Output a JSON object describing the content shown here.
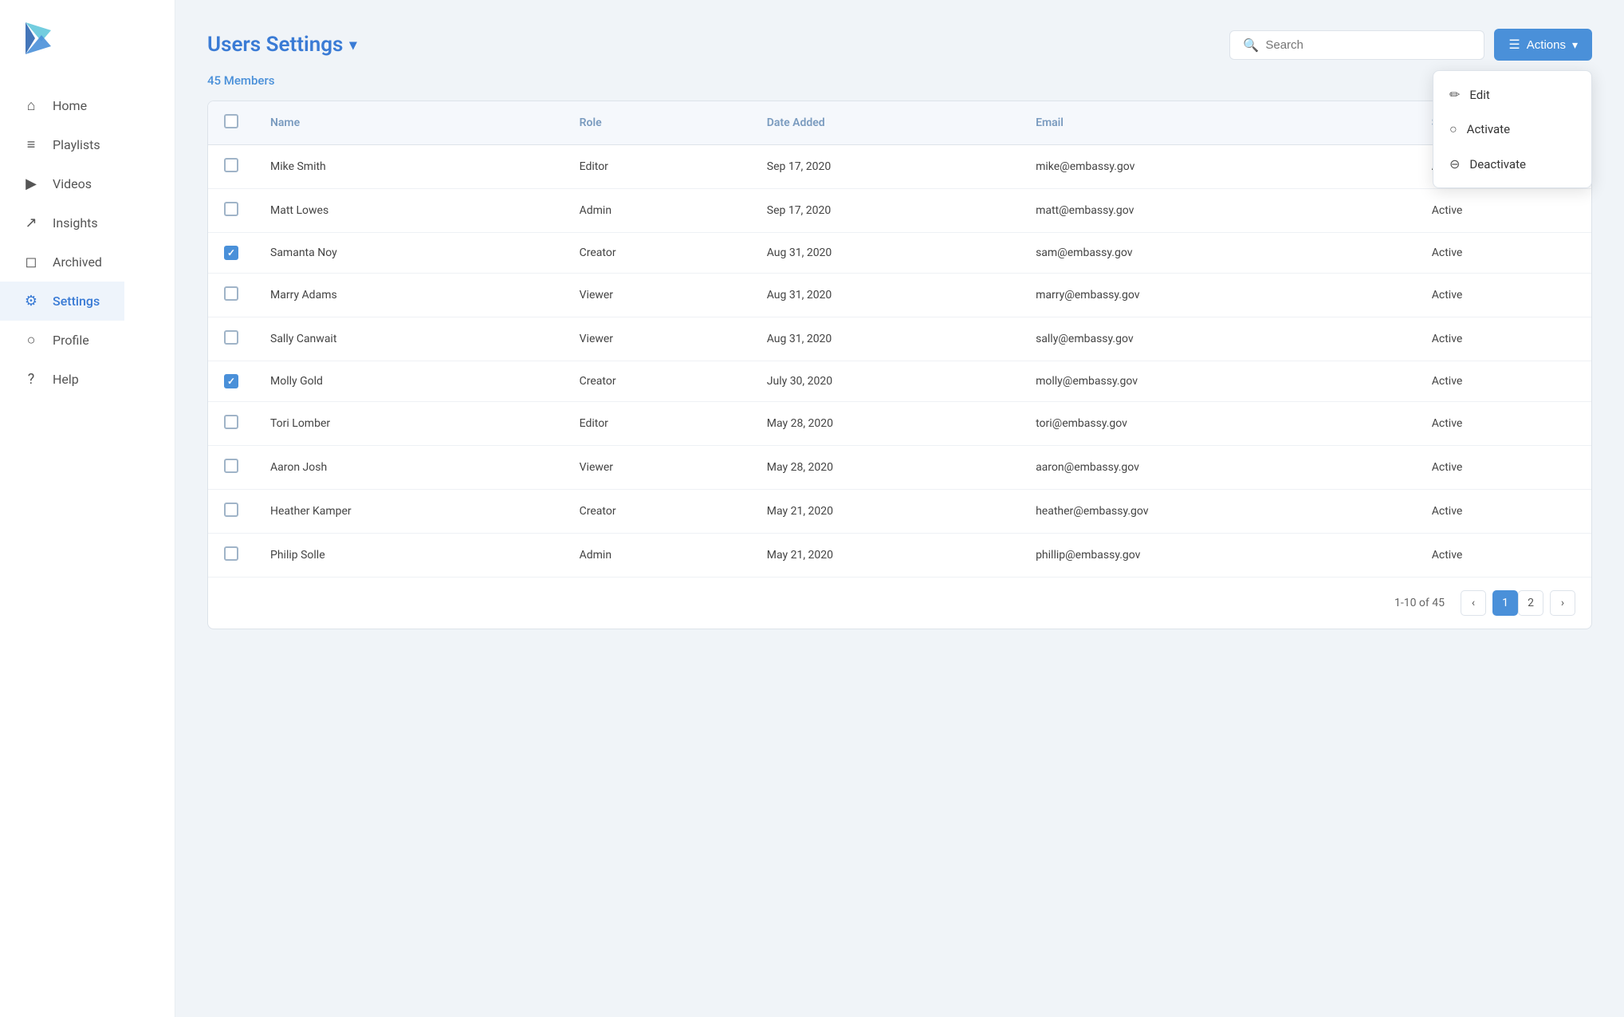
{
  "sidebar": {
    "logo_alt": "PlayVS logo",
    "items": [
      {
        "id": "home",
        "label": "Home",
        "icon": "⌂",
        "active": false
      },
      {
        "id": "playlists",
        "label": "Playlists",
        "icon": "≡",
        "active": false
      },
      {
        "id": "videos",
        "label": "Videos",
        "icon": "▶",
        "active": false
      },
      {
        "id": "insights",
        "label": "Insights",
        "icon": "📈",
        "active": false
      },
      {
        "id": "archived",
        "label": "Archived",
        "icon": "⬡",
        "active": false
      },
      {
        "id": "settings",
        "label": "Settings",
        "icon": "⚙",
        "active": true
      },
      {
        "id": "profile",
        "label": "Profile",
        "icon": "👤",
        "active": false
      },
      {
        "id": "help",
        "label": "Help",
        "icon": "?",
        "active": false
      }
    ]
  },
  "header": {
    "page_title": "Users Settings",
    "chevron_label": "▾",
    "members_count": "45 Members",
    "search_placeholder": "Search",
    "actions_label": "Actions",
    "actions_chevron": "▾"
  },
  "actions_dropdown": {
    "items": [
      {
        "id": "edit",
        "label": "Edit",
        "icon": "✏"
      },
      {
        "id": "activate",
        "label": "Activate",
        "icon": "○"
      },
      {
        "id": "deactivate",
        "label": "Deactivate",
        "icon": "⊖"
      }
    ]
  },
  "table": {
    "columns": [
      "",
      "Name",
      "Role",
      "Date Added",
      "Email",
      "Status"
    ],
    "rows": [
      {
        "checked": false,
        "name": "Mike Smith",
        "role": "Editor",
        "date": "Sep 17, 2020",
        "email": "mike@embassy.gov",
        "status": "Active"
      },
      {
        "checked": false,
        "name": "Matt Lowes",
        "role": "Admin",
        "date": "Sep 17, 2020",
        "email": "matt@embassy.gov",
        "status": "Active"
      },
      {
        "checked": true,
        "name": "Samanta Noy",
        "role": "Creator",
        "date": "Aug 31, 2020",
        "email": "sam@embassy.gov",
        "status": "Active"
      },
      {
        "checked": false,
        "name": "Marry Adams",
        "role": "Viewer",
        "date": "Aug 31, 2020",
        "email": "marry@embassy.gov",
        "status": "Active"
      },
      {
        "checked": false,
        "name": "Sally Canwait",
        "role": "Viewer",
        "date": "Aug 31, 2020",
        "email": "sally@embassy.gov",
        "status": "Active"
      },
      {
        "checked": true,
        "name": "Molly Gold",
        "role": "Creator",
        "date": "July 30, 2020",
        "email": "molly@embassy.gov",
        "status": "Active"
      },
      {
        "checked": false,
        "name": "Tori Lomber",
        "role": "Editor",
        "date": "May 28, 2020",
        "email": "tori@embassy.gov",
        "status": "Active"
      },
      {
        "checked": false,
        "name": "Aaron Josh",
        "role": "Viewer",
        "date": "May 28, 2020",
        "email": "aaron@embassy.gov",
        "status": "Active"
      },
      {
        "checked": false,
        "name": "Heather Kamper",
        "role": "Creator",
        "date": "May 21, 2020",
        "email": "heather@embassy.gov",
        "status": "Active"
      },
      {
        "checked": false,
        "name": "Philip Solle",
        "role": "Admin",
        "date": "May 21, 2020",
        "email": "phillip@embassy.gov",
        "status": "Active"
      }
    ]
  },
  "pagination": {
    "range": "1-10 of 45",
    "current_page": 1,
    "pages": [
      1,
      2
    ],
    "prev_icon": "‹",
    "next_icon": "›"
  },
  "colors": {
    "accent": "#4a90d9",
    "active_bg": "#eef4fb"
  }
}
